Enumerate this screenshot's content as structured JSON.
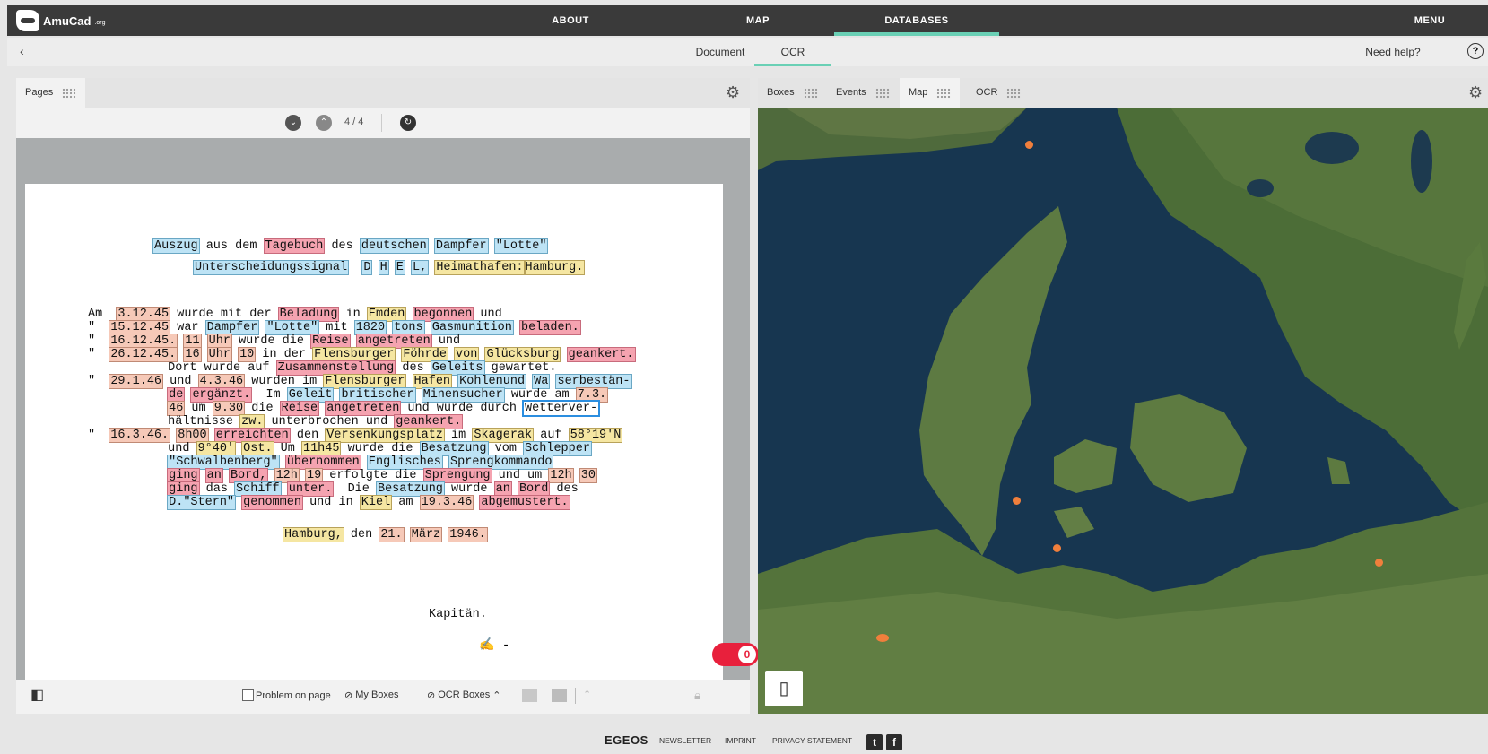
{
  "nav": {
    "logo": "AmuCad",
    "logo_suffix": ".org",
    "links": [
      "ABOUT",
      "MAP",
      "DATABASES"
    ],
    "menu": "MENU"
  },
  "subnav": {
    "back_icon": "chevron-left-icon",
    "tabs": [
      "Document",
      "OCR"
    ],
    "help": "Need help?"
  },
  "left_panel": {
    "tab": "Pages",
    "page_indicator": "4 / 4",
    "toggle_value": "0",
    "bottom": {
      "problem_label": "Problem on page",
      "my_boxes": "My Boxes",
      "ocr_boxes": "OCR Boxes"
    },
    "document": {
      "lines": [
        [
          [
            "Auszug",
            "b"
          ],
          [
            " aus dem ",
            ""
          ],
          [
            "Tagebuch",
            "p"
          ],
          [
            " des ",
            ""
          ],
          [
            "deutschen",
            "b"
          ],
          [
            " ",
            ""
          ],
          [
            "Dampfer",
            "b"
          ],
          [
            " ",
            ""
          ],
          [
            "\"Lotte\"",
            "b"
          ]
        ],
        [
          [
            "Unterscheidungssignal",
            "b"
          ],
          [
            "  ",
            ""
          ],
          [
            "D",
            "b"
          ],
          [
            " ",
            ""
          ],
          [
            "H",
            "b"
          ],
          [
            " ",
            ""
          ],
          [
            "E",
            "b"
          ],
          [
            " ",
            ""
          ],
          [
            "L,",
            "b"
          ],
          [
            " ",
            ""
          ],
          [
            "Heimathafen:",
            "y"
          ],
          [
            "Hamburg.",
            "y"
          ]
        ],
        [
          [
            "Am  ",
            ""
          ],
          [
            "3.12.45",
            "o"
          ],
          [
            " wurde mit der ",
            ""
          ],
          [
            "Beladung",
            "p"
          ],
          [
            " in ",
            ""
          ],
          [
            "Emden",
            "y"
          ],
          [
            " ",
            ""
          ],
          [
            "begonnen",
            "p"
          ],
          [
            " und",
            ""
          ]
        ],
        [
          [
            "\"  ",
            ""
          ],
          [
            "15.12.45",
            "o"
          ],
          [
            " war ",
            ""
          ],
          [
            "Dampfer",
            "b"
          ],
          [
            " ",
            ""
          ],
          [
            "\"Lotte\"",
            "b"
          ],
          [
            " mit ",
            ""
          ],
          [
            "1820",
            "b"
          ],
          [
            " ",
            ""
          ],
          [
            "tons",
            "b"
          ],
          [
            " ",
            ""
          ],
          [
            "Gasmunition",
            "b"
          ],
          [
            " ",
            ""
          ],
          [
            "beladen.",
            "p"
          ]
        ],
        [
          [
            "\"  ",
            ""
          ],
          [
            "16.12.45.",
            "o"
          ],
          [
            " ",
            ""
          ],
          [
            "11",
            "o"
          ],
          [
            " ",
            ""
          ],
          [
            "Uhr",
            "o"
          ],
          [
            " wurde die ",
            ""
          ],
          [
            "Reise",
            "p"
          ],
          [
            " ",
            ""
          ],
          [
            "angetreten",
            "p"
          ],
          [
            " und",
            ""
          ]
        ],
        [
          [
            "\"  ",
            ""
          ],
          [
            "26.12.45.",
            "o"
          ],
          [
            " ",
            ""
          ],
          [
            "16",
            "o"
          ],
          [
            " ",
            ""
          ],
          [
            "Uhr",
            "o"
          ],
          [
            " ",
            ""
          ],
          [
            "10",
            "o"
          ],
          [
            " in der ",
            ""
          ],
          [
            "Flensburger",
            "y"
          ],
          [
            " ",
            ""
          ],
          [
            "Föhrde",
            "y"
          ],
          [
            " ",
            ""
          ],
          [
            "von",
            "y"
          ],
          [
            " ",
            ""
          ],
          [
            "Glücksburg",
            "y"
          ],
          [
            " ",
            ""
          ],
          [
            "geankert.",
            "p"
          ]
        ],
        [
          [
            "           Dort wurde auf ",
            ""
          ],
          [
            "Zusammenstellung",
            "p"
          ],
          [
            " des ",
            ""
          ],
          [
            "Geleits",
            "b"
          ],
          [
            " gewartet.",
            ""
          ]
        ],
        [
          [
            "\"  ",
            ""
          ],
          [
            "29.1.46",
            "o"
          ],
          [
            " und ",
            ""
          ],
          [
            "4.3.46",
            "o"
          ],
          [
            " wurden im ",
            ""
          ],
          [
            "Flensburger",
            "y"
          ],
          [
            " ",
            ""
          ],
          [
            "Hafen",
            "y"
          ],
          [
            " ",
            ""
          ],
          [
            "Kohlenund",
            "b"
          ],
          [
            " ",
            ""
          ],
          [
            "Wa",
            "b"
          ],
          [
            " ",
            ""
          ],
          [
            "serbestän-",
            "b"
          ]
        ],
        [
          [
            "           ",
            ""
          ],
          [
            "de",
            "p"
          ],
          [
            " ",
            ""
          ],
          [
            "ergänzt.",
            "p"
          ],
          [
            "  Im ",
            ""
          ],
          [
            "Geleit",
            "b"
          ],
          [
            " ",
            ""
          ],
          [
            "britischer",
            "b"
          ],
          [
            " ",
            ""
          ],
          [
            "Minensucher",
            "b"
          ],
          [
            " wurde am ",
            ""
          ],
          [
            "7.3.",
            "o"
          ]
        ],
        [
          [
            "           ",
            ""
          ],
          [
            "46",
            "o"
          ],
          [
            " um ",
            ""
          ],
          [
            "9.30",
            "o"
          ],
          [
            " die ",
            ""
          ],
          [
            "Reise",
            "p"
          ],
          [
            " ",
            ""
          ],
          [
            "angetreten",
            "p"
          ],
          [
            " und wurde durch ",
            ""
          ],
          [
            "Wetterver-",
            "sel"
          ]
        ],
        [
          [
            "           hältnisse ",
            ""
          ],
          [
            "zw.",
            "y"
          ],
          [
            " unterbrochen und ",
            ""
          ],
          [
            "geankert.",
            "p"
          ]
        ],
        [
          [
            "\"  ",
            ""
          ],
          [
            "16.3.46.",
            "o"
          ],
          [
            " ",
            ""
          ],
          [
            "8h00",
            "o"
          ],
          [
            " ",
            ""
          ],
          [
            "erreichten",
            "p"
          ],
          [
            " den ",
            ""
          ],
          [
            "Versenkungsplatz",
            "y"
          ],
          [
            " im ",
            ""
          ],
          [
            "Skagerak",
            "y"
          ],
          [
            " auf ",
            ""
          ],
          [
            "58°19'N",
            "y"
          ]
        ],
        [
          [
            "           und ",
            ""
          ],
          [
            "9°40'",
            "y"
          ],
          [
            " ",
            ""
          ],
          [
            "Ost.",
            "y"
          ],
          [
            " Um ",
            ""
          ],
          [
            "11h45",
            "y"
          ],
          [
            " wurde die ",
            ""
          ],
          [
            "Besatzung",
            "b"
          ],
          [
            " vom ",
            ""
          ],
          [
            "Schlepper",
            "b"
          ]
        ],
        [
          [
            "           ",
            ""
          ],
          [
            "\"Schwalbenberg\"",
            "b"
          ],
          [
            " ",
            ""
          ],
          [
            "übernommen",
            "p"
          ],
          [
            " ",
            ""
          ],
          [
            "Englisches",
            "b"
          ],
          [
            " ",
            ""
          ],
          [
            "Sprengkommando",
            "b"
          ]
        ],
        [
          [
            "           ",
            ""
          ],
          [
            "ging",
            "p"
          ],
          [
            " ",
            ""
          ],
          [
            "an",
            "p"
          ],
          [
            " ",
            ""
          ],
          [
            "Bord,",
            "p"
          ],
          [
            " ",
            ""
          ],
          [
            "12h",
            "o"
          ],
          [
            " ",
            ""
          ],
          [
            "19",
            "o"
          ],
          [
            " erfolgte die ",
            ""
          ],
          [
            "Sprengung",
            "p"
          ],
          [
            " und um ",
            ""
          ],
          [
            "12h",
            "o"
          ],
          [
            " ",
            ""
          ],
          [
            "30",
            "o"
          ]
        ],
        [
          [
            "           ",
            ""
          ],
          [
            "ging",
            "p"
          ],
          [
            " das ",
            ""
          ],
          [
            "Schiff",
            "b"
          ],
          [
            " ",
            ""
          ],
          [
            "unter.",
            "p"
          ],
          [
            "  Die ",
            ""
          ],
          [
            "Besatzung",
            "b"
          ],
          [
            " wurde ",
            ""
          ],
          [
            "an",
            "p"
          ],
          [
            " ",
            ""
          ],
          [
            "Bord",
            "p"
          ],
          [
            " des",
            ""
          ]
        ],
        [
          [
            "           ",
            ""
          ],
          [
            "D.\"Stern\"",
            "b"
          ],
          [
            " ",
            ""
          ],
          [
            "genommen",
            "p"
          ],
          [
            " und in ",
            ""
          ],
          [
            "Kiel",
            "y"
          ],
          [
            " am ",
            ""
          ],
          [
            "19.3.46",
            "o"
          ],
          [
            " ",
            ""
          ],
          [
            "abgemustert.",
            "p"
          ]
        ],
        [
          [
            "Hamburg,",
            "y"
          ],
          [
            " den ",
            ""
          ],
          [
            "21.",
            "o"
          ],
          [
            " ",
            ""
          ],
          [
            "März",
            "o"
          ],
          [
            " ",
            ""
          ],
          [
            "1946.",
            "o"
          ]
        ],
        [
          [
            "Kapitän.",
            ""
          ]
        ]
      ]
    }
  },
  "right_panel": {
    "tabs": [
      "Boxes",
      "Events",
      "Map",
      "OCR"
    ]
  },
  "footer": {
    "brand": "EGEOS",
    "links": [
      "NEWSLETTER",
      "IMPRINT",
      "PRIVACY STATEMENT"
    ]
  },
  "colors": {
    "accent": "#6ad0b5",
    "toggle": "#e8203c",
    "marker": "#f07f3c"
  }
}
